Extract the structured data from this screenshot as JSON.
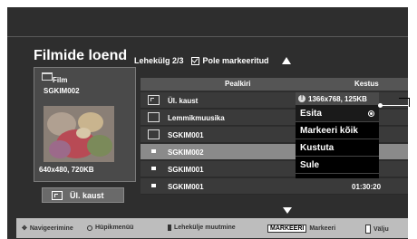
{
  "title": "Filmide loend",
  "page_info": "Lehekülg 2/3",
  "unmarked_label": "Pole markeeritud",
  "preview": {
    "folder_label": "Film",
    "file_name": "SGKIM002",
    "resolution": "640x480, 720KB"
  },
  "up_button_label": "Ül. kaust",
  "table": {
    "columns": [
      "Pealkiri",
      "Kestus"
    ],
    "rows": [
      {
        "type": "up-folder",
        "name": "Ül. kaust",
        "duration": ""
      },
      {
        "type": "folder",
        "name": "Lemmikmuusika",
        "duration": ""
      },
      {
        "type": "folder",
        "name": "SGKIM001",
        "duration": ""
      },
      {
        "type": "file",
        "name": "SGKIM002",
        "duration": "",
        "selected": true
      },
      {
        "type": "file",
        "name": "SGKIM001",
        "duration": ""
      },
      {
        "type": "file",
        "name": "SGKIM001",
        "duration": "01:30:20"
      }
    ]
  },
  "popup": {
    "info": "1366x768, 125KB",
    "items": [
      "Esita",
      "Markeeri kõik",
      "Kustuta",
      "Sule"
    ]
  },
  "bottom_bar": {
    "navigate": "Navigeerimine",
    "popup_menu": "Hüpikmenüü",
    "page_change": "Lehekülje muutmine",
    "mark_key": "MARKEERI",
    "mark": "Markeeri",
    "exit": "Välju"
  }
}
